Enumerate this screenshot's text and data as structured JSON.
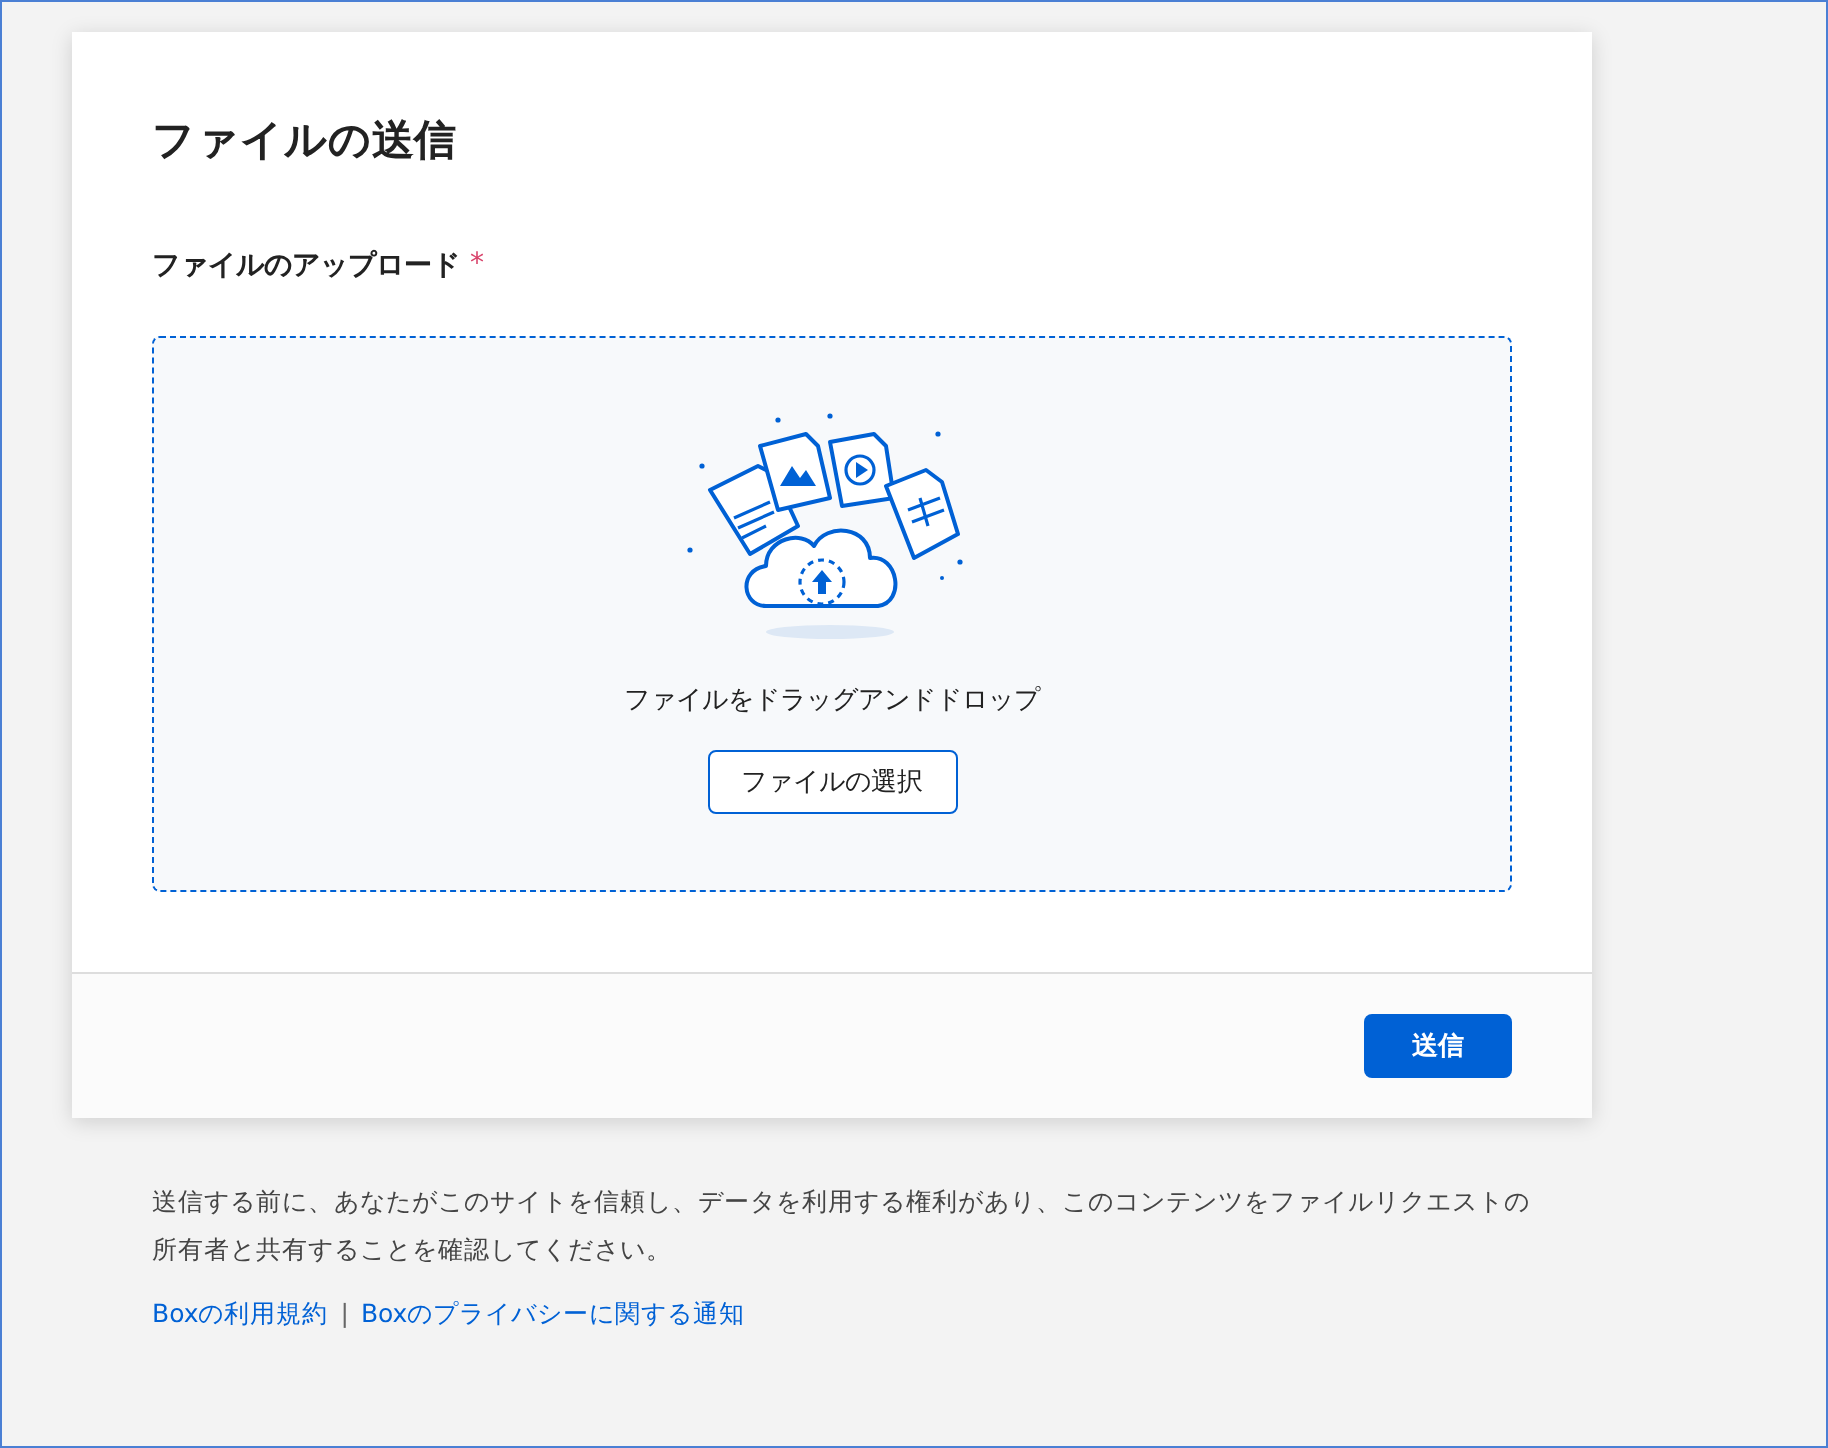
{
  "title": "ファイルの送信",
  "upload": {
    "label": "ファイルのアップロード",
    "required_mark": "*",
    "drop_text": "ファイルをドラッグアンドドロップ",
    "choose_button": "ファイルの選択"
  },
  "submit_button": "送信",
  "disclaimer": "送信する前に、あなたがこのサイトを信頼し、データを利用する権利があり、このコンテンツをファイルリクエストの所有者と共有することを確認してください。",
  "links": [
    "Boxの利用規約",
    "Boxのプライバシーに関する通知"
  ],
  "link_separator": "|"
}
